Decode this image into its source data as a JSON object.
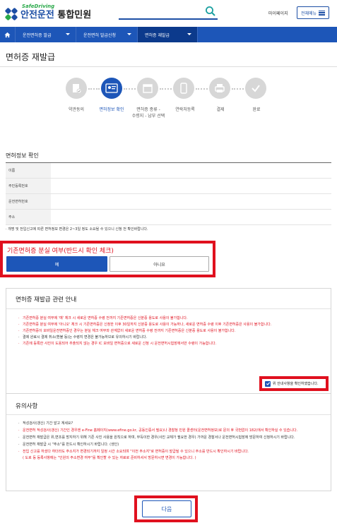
{
  "header": {
    "logo_en": "SafeDriving",
    "logo_ko_1": "안전운전",
    "logo_ko_2": " 통합민원",
    "mypage": "마이페이지",
    "all_menu": "전체메뉴"
  },
  "nav": {
    "items": [
      {
        "label": "운전면허증 발급"
      },
      {
        "label": "운전면허 발급신청"
      },
      {
        "label": "면허증 재발급"
      }
    ]
  },
  "page_title": "면허증 재발급",
  "steps": [
    {
      "label": "약관동의",
      "icon": "document-check-icon"
    },
    {
      "label": "면허정보 확인",
      "icon": "license-card-icon"
    },
    {
      "label": "면허증 종류 -\n수령지 - 납부 선택",
      "icon": "calendar-icon"
    },
    {
      "label": "연락처등록",
      "icon": "phone-icon"
    },
    {
      "label": "결제",
      "icon": "printer-icon"
    },
    {
      "label": "완료",
      "icon": "checkmark-icon"
    }
  ],
  "license_info": {
    "title": "면허정보 확인",
    "rows": [
      {
        "label": "이름",
        "value": ""
      },
      {
        "label": "주민등록번호",
        "value": ""
      },
      {
        "label": "운전면허번호",
        "value": ""
      },
      {
        "label": "주소",
        "value": ""
      }
    ],
    "note": "· 개명 및 전입신고에 따른 면허정보 변경은 2~3일 정도 소요될 수 있으니 신청 전 확인바랍니다."
  },
  "lost_question": {
    "title": "기존면허증 분실 여부(반드시 확인 체크)",
    "yes": "예",
    "no": "아니요"
  },
  "guide": {
    "title": "면허증 재발급 관련 안내",
    "items": [
      {
        "text": "기존면허증 분실 여부에 '예' 체크 시 새로운 면허증 수령 전까지 기존면허증은 신분증 용도로 사용이 불가합니다.",
        "color": "red"
      },
      {
        "text": "기존면허증 분실 여부에 '아니오' 체크 시 기존면허증은 신청한 이후 30일까지 신분증 용도로 사용이 가능하나, 새로운 면허증 수령 이후 기존면허증은 사용이 불가합니다.",
        "color": "red"
      },
      {
        "text": "기존면허증이 모바일운전면허증인 경우는 분실 체크 여부와 관계없이 새로운 면허증 수령 전까지 기존면허증은 신분증 용도로 사용이 불가합니다.",
        "color": "red"
      },
      {
        "text": "결제 완료시 결제 취소(환불 등)는 수령지 변경은 불가능하므로 유의하시기 바랍니다.",
        "color": "blk"
      },
      {
        "text": "기존에 등록한 사진이 도용되어 추출되지 않는 경우 IC 모바일 면허증으로 새로운 신청 시 운전면허시험장에서만 수령이 가능합니다.",
        "color": "red"
      }
    ],
    "confirm_label": "위 안내사항을 확인하였습니다."
  },
  "notes": {
    "title": "유의사항",
    "items": [
      {
        "text": "적성검사(갱신) 기간 앞고 계세요?",
        "color": "blk"
      },
      {
        "text": "운전면허 적성검사(갱신) 기간인 경우엔 e-Fine 홈페이지(www.efine.go.kr, 공동인증서 필요)나 경찰청 민원 콜센터(운전면허정보)로 문의 후 국번없이 182(에서 확인하실 수 있습니다.",
        "color": "red"
      },
      {
        "text": "운전면허 재발급은 위,변조를 방지하기 위해 기존 사진 사용을 원칙으로 하며, 부득이한 경우(사진 교체가 필요한 경우) 가까운 경찰서나 운전면허시험장에 방문하여 신청하시기 바랍니다.",
        "color": "blk"
      },
      {
        "text": "운전면허 재발급 시 \"주소\"를 반드시 확인하시기 바랍니다. (생인)",
        "color": "blk"
      },
      {
        "text": "전입 신고를 하셨다 하더라도 주소지가 변경되기까지 일정 시간 소요되며 \"이전 주소지\"로 면허증이 발급될 수 있으니 주소를 반드시 확인하시기 바랍니다.\n( 도로 등 등록사항에는 \"인원의 주소변경 여부\"를 확인할 수 있는 자료로 준비하셔서 방문하시면 변경이 가능합니다. )",
        "color": "red"
      }
    ]
  },
  "next_button": "다음",
  "colors": {
    "brand": "#1d56b8",
    "alert": "#e0101e",
    "green": "#2aa94a"
  }
}
